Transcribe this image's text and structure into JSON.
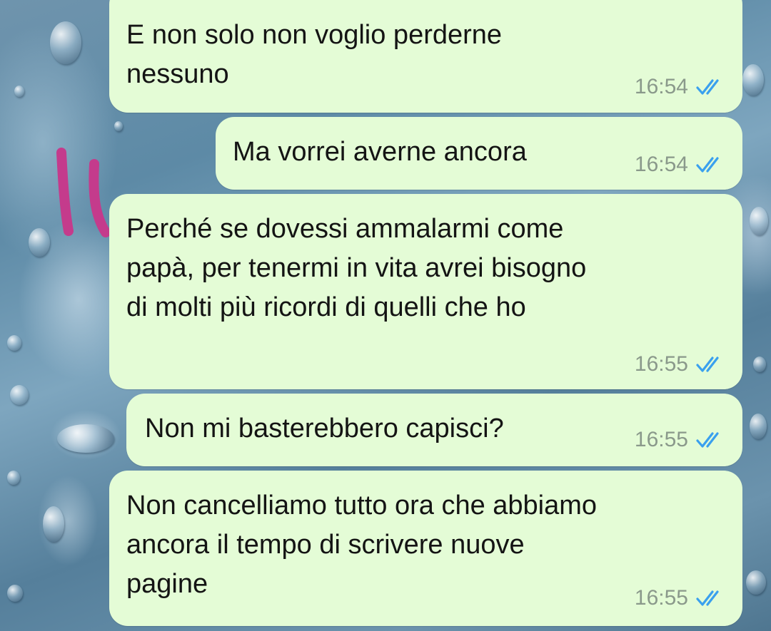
{
  "chat": {
    "messages": [
      {
        "text": "E non solo non voglio perderne\nnessuno",
        "time": "16:54",
        "status_icon": "double-check-read-icon"
      },
      {
        "text": "Ma vorrei averne ancora",
        "time": "16:54",
        "status_icon": "double-check-read-icon"
      },
      {
        "text": "Perché se dovessi ammalarmi come\npapà, per tenermi in vita avrei bisogno\ndi molti più ricordi di quelli che ho",
        "time": "16:55",
        "status_icon": "double-check-read-icon"
      },
      {
        "text": "Non mi basterebbero capisci?",
        "time": "16:55",
        "status_icon": "double-check-read-icon"
      },
      {
        "text": "Non cancelliamo tutto ora che abbiamo\nancora il tempo di scrivere nuove\npagine",
        "time": "16:55",
        "status_icon": "double-check-read-icon"
      }
    ]
  },
  "colors": {
    "bubble_background": "#e4fcd6",
    "read_tick": "#3aa0ee",
    "annotation_mark": "#c43b8c"
  }
}
